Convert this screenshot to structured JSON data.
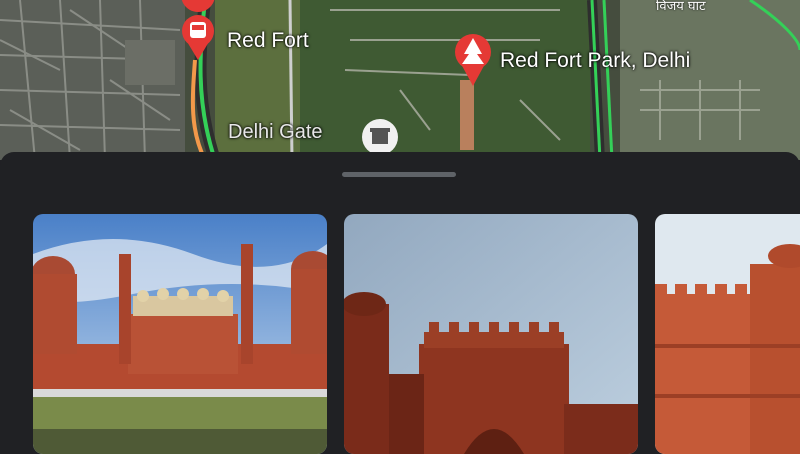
{
  "map": {
    "places": [
      {
        "name": "Red Fort",
        "icon": "metro-station-icon"
      },
      {
        "name": "Red Fort Park, Delhi",
        "icon": "park-tree-icon"
      },
      {
        "name": "Delhi Gate",
        "icon": "monument-icon"
      }
    ],
    "partial_label": "विजय घाट"
  },
  "sheet": {
    "photos": [
      {
        "subject": "Red Fort facade with minarets and domes"
      },
      {
        "subject": "Red Fort gate against grey sky"
      },
      {
        "subject": "Red Fort walls under clear sky"
      }
    ]
  },
  "colors": {
    "sheet_bg": "#202124",
    "pin_red": "#e53935",
    "road_green": "#34d058",
    "road_orange": "#f2994a"
  }
}
